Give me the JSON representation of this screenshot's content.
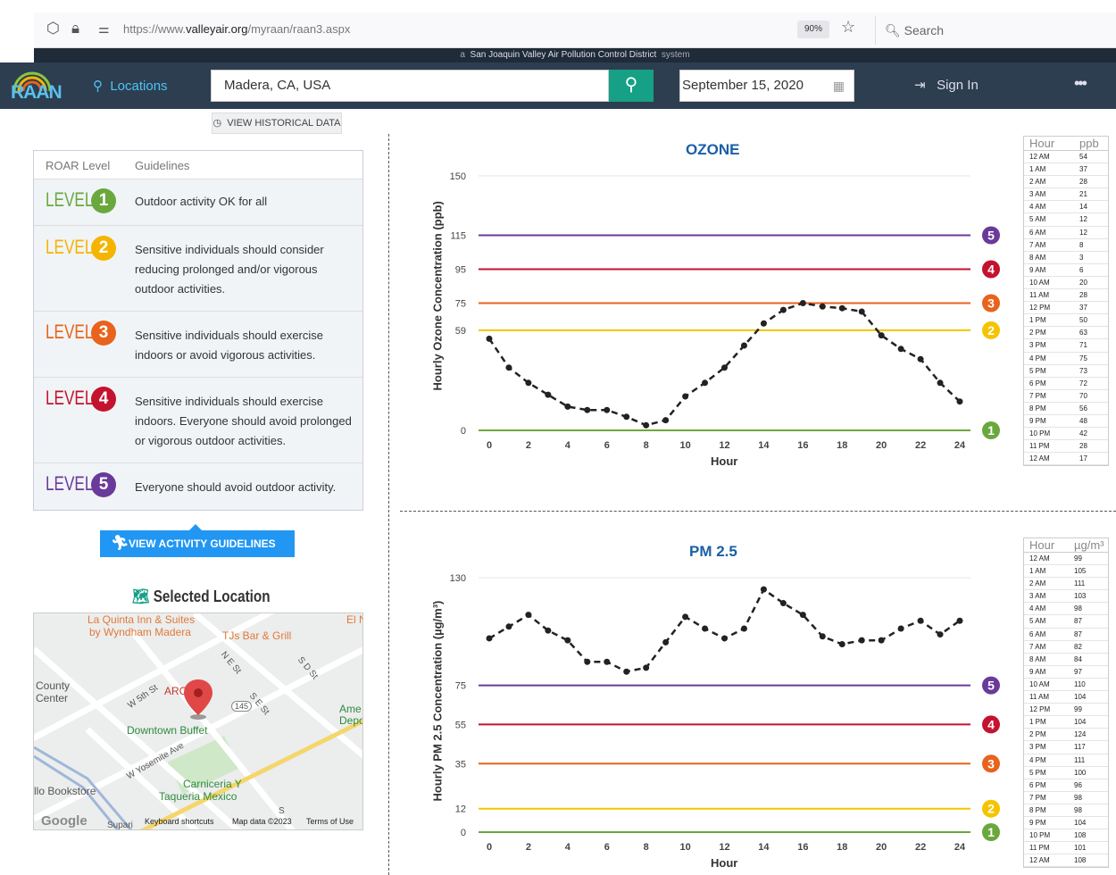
{
  "browser": {
    "url_prefix": "https://www.",
    "url_domain": "valleyair.org",
    "url_path": "/myraan/raan3.aspx",
    "zoom": "90%",
    "search_placeholder": "Search"
  },
  "strip": {
    "pre": "a",
    "district": "San Joaquin Valley Air Pollution Control District",
    "post": "system"
  },
  "nav": {
    "logo": "RAAN",
    "locations": "Locations",
    "location_value": "Madera, CA, USA",
    "date": "September 15, 2020",
    "sign_in": "Sign In",
    "more": "•••"
  },
  "historical_button": "VIEW HISTORICAL DATA",
  "guidelines": {
    "col_level": "ROAR Level",
    "col_guidelines": "Guidelines",
    "level_word": "LEVEL",
    "rows": [
      {
        "num": "1",
        "color": "#6aa83e",
        "text": "Outdoor activity OK for all"
      },
      {
        "num": "2",
        "color": "#f5b400",
        "text": "Sensitive individuals should consider reducing prolonged and/or vigorous outdoor activities."
      },
      {
        "num": "3",
        "color": "#e8631c",
        "text": "Sensitive individuals should exercise indoors or avoid vigorous activities."
      },
      {
        "num": "4",
        "color": "#c4122f",
        "text": "Sensitive individuals should exercise indoors. Everyone should avoid prolonged or vigorous outdoor activities."
      },
      {
        "num": "5",
        "color": "#6a3a9a",
        "text": "Everyone should avoid outdoor activity."
      }
    ]
  },
  "activity_button": "VIEW ACTIVITY GUIDELINES",
  "selected_location": "Selected Location",
  "map": {
    "labels": [
      "La Quinta Inn & Suites",
      "by Wyndham Madera",
      "TJs Bar & Grill",
      "County",
      "Center",
      "ARC",
      "W 5th St",
      "N E St",
      "S D St",
      "S E St",
      "145",
      "Downtown Buffet",
      "W Yosemite Ave",
      "Carniceria Y",
      "Taqueria Mexico",
      "llo Bookstore",
      "Ame",
      "Depo",
      "El N",
      "S",
      "Supari"
    ],
    "footer_shortcuts": "Keyboard shortcuts",
    "footer_data": "Map data ©2023",
    "footer_terms": "Terms of Use",
    "google": "Google"
  },
  "chart_data": [
    {
      "type": "line",
      "title": "OZONE",
      "ylabel": "Hourly Ozone Concentration (ppb)",
      "xlabel": "Hour",
      "x": [
        0,
        1,
        2,
        3,
        4,
        5,
        6,
        7,
        8,
        9,
        10,
        11,
        12,
        13,
        14,
        15,
        16,
        17,
        18,
        19,
        20,
        21,
        22,
        23,
        24
      ],
      "y": [
        54,
        37,
        28,
        21,
        14,
        12,
        12,
        8,
        3,
        6,
        20,
        28,
        37,
        50,
        63,
        71,
        75,
        73,
        72,
        70,
        56,
        48,
        42,
        28,
        17
      ],
      "ylim": [
        0,
        150
      ],
      "y_ticks": [
        0,
        59,
        75,
        95,
        115,
        150
      ],
      "x_ticks": [
        0,
        2,
        4,
        6,
        8,
        10,
        12,
        14,
        16,
        18,
        20,
        22,
        24
      ],
      "thresholds": [
        {
          "level": "1",
          "value": 0,
          "color": "#6aa83e"
        },
        {
          "level": "2",
          "value": 59,
          "color": "#f5c400"
        },
        {
          "level": "3",
          "value": 75,
          "color": "#e8631c"
        },
        {
          "level": "4",
          "value": 95,
          "color": "#c4122f"
        },
        {
          "level": "5",
          "value": 115,
          "color": "#6a3a9a"
        }
      ],
      "table_header": [
        "Hour",
        "ppb"
      ],
      "table_rows": [
        [
          "12 AM",
          "54"
        ],
        [
          "1 AM",
          "37"
        ],
        [
          "2 AM",
          "28"
        ],
        [
          "3 AM",
          "21"
        ],
        [
          "4 AM",
          "14"
        ],
        [
          "5 AM",
          "12"
        ],
        [
          "6 AM",
          "12"
        ],
        [
          "7 AM",
          "8"
        ],
        [
          "8 AM",
          "3"
        ],
        [
          "9 AM",
          "6"
        ],
        [
          "10 AM",
          "20"
        ],
        [
          "11 AM",
          "28"
        ],
        [
          "12 PM",
          "37"
        ],
        [
          "1 PM",
          "50"
        ],
        [
          "2 PM",
          "63"
        ],
        [
          "3 PM",
          "71"
        ],
        [
          "4 PM",
          "75"
        ],
        [
          "5 PM",
          "73"
        ],
        [
          "6 PM",
          "72"
        ],
        [
          "7 PM",
          "70"
        ],
        [
          "8 PM",
          "56"
        ],
        [
          "9 PM",
          "48"
        ],
        [
          "10 PM",
          "42"
        ],
        [
          "11 PM",
          "28"
        ],
        [
          "12 AM",
          "17"
        ]
      ]
    },
    {
      "type": "line",
      "title": "PM 2.5",
      "ylabel": "Hourly PM 2.5 Concentration (µg/m³)",
      "xlabel": "Hour",
      "x": [
        0,
        1,
        2,
        3,
        4,
        5,
        6,
        7,
        8,
        9,
        10,
        11,
        12,
        13,
        14,
        15,
        16,
        17,
        18,
        19,
        20,
        21,
        22,
        23,
        24
      ],
      "y": [
        99,
        105,
        111,
        103,
        98,
        87,
        87,
        82,
        84,
        97,
        110,
        104,
        99,
        104,
        124,
        117,
        111,
        100,
        96,
        98,
        98,
        104,
        108,
        101,
        108
      ],
      "ylim": [
        0,
        130
      ],
      "y_ticks": [
        0,
        12,
        35,
        55,
        75,
        130
      ],
      "x_ticks": [
        0,
        2,
        4,
        6,
        8,
        10,
        12,
        14,
        16,
        18,
        20,
        22,
        24
      ],
      "thresholds": [
        {
          "level": "1",
          "value": 0,
          "color": "#6aa83e"
        },
        {
          "level": "2",
          "value": 12,
          "color": "#f5c400"
        },
        {
          "level": "3",
          "value": 35,
          "color": "#e8631c"
        },
        {
          "level": "4",
          "value": 55,
          "color": "#c4122f"
        },
        {
          "level": "5",
          "value": 75,
          "color": "#6a3a9a"
        }
      ],
      "table_header": [
        "Hour",
        "µg/m³"
      ],
      "table_rows": [
        [
          "12 AM",
          "99"
        ],
        [
          "1 AM",
          "105"
        ],
        [
          "2 AM",
          "111"
        ],
        [
          "3 AM",
          "103"
        ],
        [
          "4 AM",
          "98"
        ],
        [
          "5 AM",
          "87"
        ],
        [
          "6 AM",
          "87"
        ],
        [
          "7 AM",
          "82"
        ],
        [
          "8 AM",
          "84"
        ],
        [
          "9 AM",
          "97"
        ],
        [
          "10 AM",
          "110"
        ],
        [
          "11 AM",
          "104"
        ],
        [
          "12 PM",
          "99"
        ],
        [
          "1 PM",
          "104"
        ],
        [
          "2 PM",
          "124"
        ],
        [
          "3 PM",
          "117"
        ],
        [
          "4 PM",
          "111"
        ],
        [
          "5 PM",
          "100"
        ],
        [
          "6 PM",
          "96"
        ],
        [
          "7 PM",
          "98"
        ],
        [
          "8 PM",
          "98"
        ],
        [
          "9 PM",
          "104"
        ],
        [
          "10 PM",
          "108"
        ],
        [
          "11 PM",
          "101"
        ],
        [
          "12 AM",
          "108"
        ]
      ]
    }
  ]
}
